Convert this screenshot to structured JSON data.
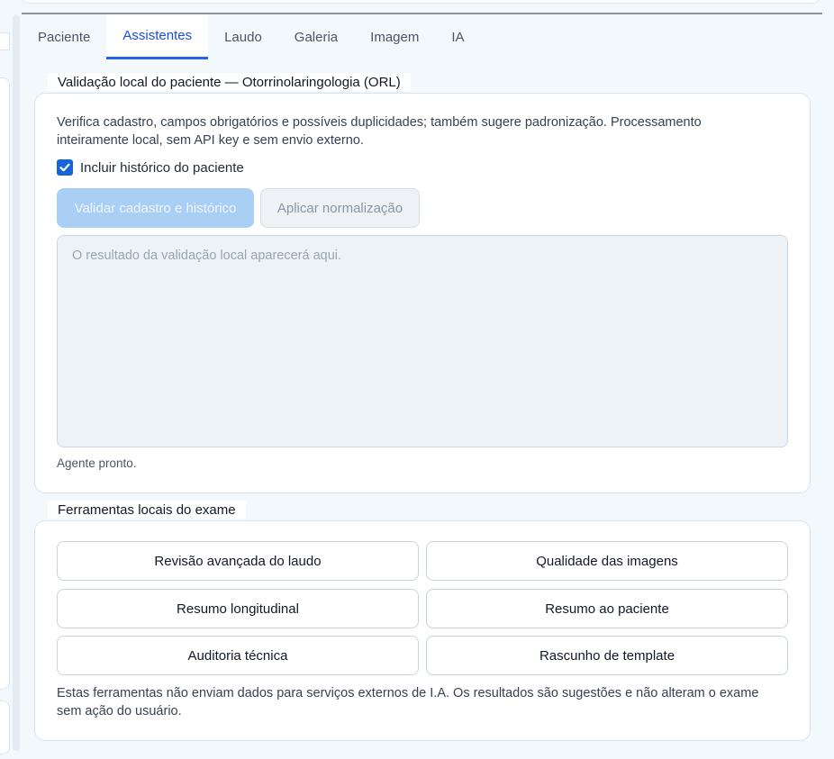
{
  "tabs": [
    "Paciente",
    "Assistentes",
    "Laudo",
    "Galeria",
    "Imagem",
    "IA"
  ],
  "active_tab": "Assistentes",
  "validation": {
    "legend": "Validação local do paciente — Otorrinolaringologia (ORL)",
    "description": "Verifica cadastro, campos obrigatórios e possíveis duplicidades; também sugere padronização. Processamento inteiramente local, sem API key e sem envio externo.",
    "checkbox_label": "Incluir histórico do paciente",
    "checkbox_checked": true,
    "validate_button": "Validar cadastro e histórico",
    "normalize_button": "Aplicar normalização",
    "result_placeholder": "O resultado da validação local aparecerá aqui.",
    "status": "Agente pronto."
  },
  "tools": {
    "legend": "Ferramentas locais do exame",
    "buttons": [
      "Revisão avançada do laudo",
      "Qualidade das imagens",
      "Resumo longitudinal",
      "Resumo ao paciente",
      "Auditoria técnica",
      "Rascunho de template"
    ],
    "note": "Estas ferramentas não enviam dados para serviços externos de I.A. Os resultados são sugestões e não alteram o exame sem ação do usuário."
  },
  "colors": {
    "accent": "#2563eb",
    "disabled_primary": "#a9cff5",
    "background": "#f3f8fc"
  }
}
